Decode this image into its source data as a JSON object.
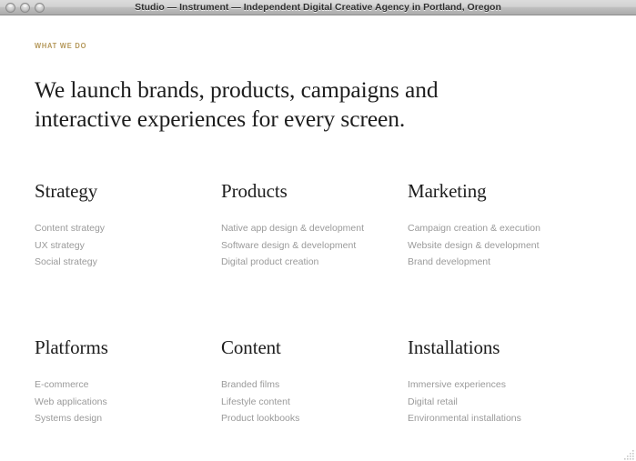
{
  "window": {
    "title": "Studio — Instrument — Independent Digital Creative Agency in Portland, Oregon",
    "controls": {
      "close_label": "close",
      "minimize_label": "minimize",
      "zoom_label": "zoom"
    }
  },
  "page": {
    "eyebrow": "WHAT WE DO",
    "headline_line1": "We launch brands, products, campaigns and",
    "headline_line2": "interactive experiences for every screen.",
    "columns": [
      {
        "title": "Strategy",
        "items": [
          "Content strategy",
          "UX strategy",
          "Social strategy"
        ]
      },
      {
        "title": "Products",
        "items": [
          "Native app design & development",
          "Software design & development",
          "Digital product creation"
        ]
      },
      {
        "title": "Marketing",
        "items": [
          "Campaign creation & execution",
          "Website design & development",
          "Brand development"
        ]
      },
      {
        "title": "Platforms",
        "items": [
          "E-commerce",
          "Web applications",
          "Systems design"
        ]
      },
      {
        "title": "Content",
        "items": [
          "Branded films",
          "Lifestyle content",
          "Product lookbooks"
        ]
      },
      {
        "title": "Installations",
        "items": [
          "Immersive experiences",
          "Digital retail",
          "Environmental installations"
        ]
      }
    ]
  },
  "colors": {
    "accent_gold": "#b5985a",
    "heading_dark": "#1d1d1d",
    "body_gray": "#9a9a9a",
    "background": "#ffffff",
    "titlebar_top": "#dcdcdc",
    "titlebar_bottom": "#ababab"
  }
}
